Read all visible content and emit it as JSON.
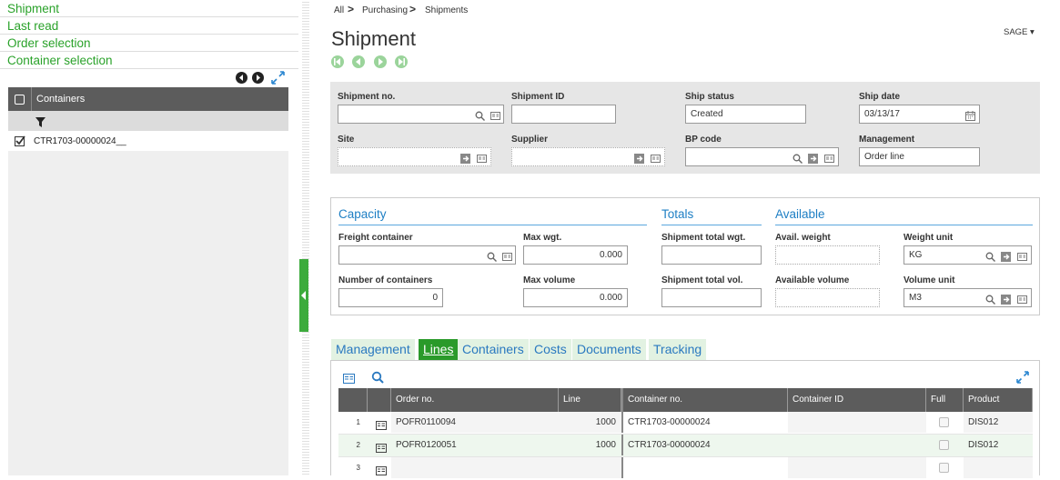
{
  "left_nav": {
    "links": [
      "Shipment",
      "Last read",
      "Order selection",
      "Container selection"
    ]
  },
  "left_panel": {
    "header": "Containers",
    "rows": [
      {
        "label": "CTR1703-00000024__"
      }
    ]
  },
  "breadcrumb": {
    "items": [
      "All",
      "Purchasing",
      "Shipments"
    ]
  },
  "page": {
    "title": "Shipment",
    "user_menu": "SAGE"
  },
  "header_fields": {
    "shipment_no": {
      "label": "Shipment no.",
      "value": ""
    },
    "shipment_id": {
      "label": "Shipment ID",
      "value": ""
    },
    "ship_status": {
      "label": "Ship status",
      "value": "Created"
    },
    "ship_date": {
      "label": "Ship date",
      "value": "03/13/17"
    },
    "site": {
      "label": "Site",
      "value": ""
    },
    "supplier": {
      "label": "Supplier",
      "value": ""
    },
    "bp_code": {
      "label": "BP code",
      "value": ""
    },
    "management": {
      "label": "Management",
      "value": "Order line"
    }
  },
  "capacity": {
    "title": "Capacity",
    "freight_container": {
      "label": "Freight container",
      "value": ""
    },
    "max_wgt": {
      "label": "Max wgt.",
      "value": "0.000"
    },
    "number_of_containers": {
      "label": "Number of containers",
      "value": "0"
    },
    "max_volume": {
      "label": "Max volume",
      "value": "0.000"
    }
  },
  "totals": {
    "title": "Totals",
    "shipment_total_wgt": {
      "label": "Shipment total wgt.",
      "value": ""
    },
    "shipment_total_vol": {
      "label": "Shipment total vol.",
      "value": ""
    }
  },
  "available": {
    "title": "Available",
    "avail_weight": {
      "label": "Avail. weight",
      "value": ""
    },
    "available_volume": {
      "label": "Available volume",
      "value": ""
    },
    "weight_unit": {
      "label": "Weight unit",
      "value": "KG"
    },
    "volume_unit": {
      "label": "Volume unit",
      "value": "M3"
    }
  },
  "tabs": [
    "Management",
    "Lines",
    "Containers",
    "Costs",
    "Documents",
    "Tracking"
  ],
  "active_tab": "Lines",
  "grid": {
    "columns": [
      "Order no.",
      "Line",
      "Container no.",
      "Container ID",
      "Full",
      "Product"
    ],
    "rows": [
      {
        "num": "1",
        "order_no": "POFR0110094",
        "line": "1000",
        "container_no": "CTR1703-00000024",
        "container_id": "",
        "product": "DIS012"
      },
      {
        "num": "2",
        "order_no": "POFR0120051",
        "line": "1000",
        "container_no": "CTR1703-00000024",
        "container_id": "",
        "product": "DIS012"
      },
      {
        "num": "3",
        "order_no": "",
        "line": "",
        "container_no": "",
        "container_id": "",
        "product": ""
      }
    ]
  },
  "colors": {
    "green": "#2aa22a",
    "blue": "#1e7fc4",
    "header_gray": "#5c5c5c"
  }
}
